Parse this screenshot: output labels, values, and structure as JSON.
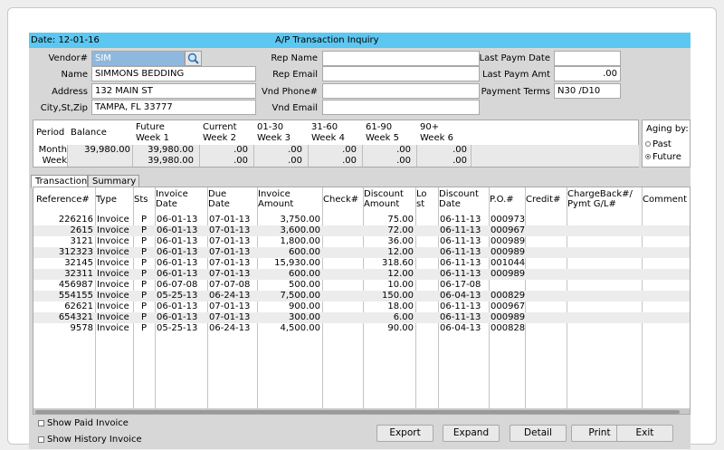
{
  "header": {
    "date": "Date: 12-01-16",
    "title": "A/P Transaction Inquiry"
  },
  "vendor": {
    "vendor_label": "Vendor#",
    "vendor_value": "SIM",
    "name_label": "Name",
    "name_value": "SIMMONS BEDDING",
    "address_label": "Address",
    "address_value": "132 MAIN ST",
    "city_label": "City,St,Zip",
    "city_value": "TAMPA, FL  33777",
    "rep_name_label": "Rep Name",
    "rep_name_value": "",
    "rep_email_label": "Rep Email",
    "rep_email_value": "",
    "vnd_phone_label": "Vnd Phone#",
    "vnd_phone_value": "",
    "vnd_email_label": "Vnd Email",
    "vnd_email_value": "",
    "last_paym_date_label": "Last Paym Date",
    "last_paym_date_value": "",
    "last_paym_amt_label": "Last Paym Amt",
    "last_paym_amt_value": ".00",
    "payment_terms_label": "Payment Terms",
    "payment_terms_value": "N30 /D10"
  },
  "aging": {
    "headers": [
      {
        "l1": "Period",
        "l2": ""
      },
      {
        "l1": "Balance",
        "l2": ""
      },
      {
        "l1": "Future",
        "l2": "Week 1"
      },
      {
        "l1": "Current",
        "l2": "Week 2"
      },
      {
        "l1": "01-30",
        "l2": "Week 3"
      },
      {
        "l1": "31-60",
        "l2": "Week 4"
      },
      {
        "l1": "61-90",
        "l2": "Week 5"
      },
      {
        "l1": "90+",
        "l2": "Week 6"
      }
    ],
    "rows": [
      {
        "period": "Month",
        "values": [
          "39,980.00",
          "39,980.00",
          ".00",
          ".00",
          ".00",
          ".00",
          ".00"
        ]
      },
      {
        "period": "Week",
        "values": [
          "",
          "39,980.00",
          ".00",
          ".00",
          ".00",
          ".00",
          ".00"
        ]
      }
    ],
    "aging_by_label": "Aging by:",
    "options": [
      "Past",
      "Future"
    ],
    "selected": "Future"
  },
  "tabs": [
    "Transaction",
    "Summary"
  ],
  "table": {
    "columns": [
      {
        "l1": "Reference#",
        "l2": ""
      },
      {
        "l1": "Type",
        "l2": ""
      },
      {
        "l1": "Sts",
        "l2": ""
      },
      {
        "l1": "Invoice",
        "l2": "Date"
      },
      {
        "l1": "Due",
        "l2": "Date"
      },
      {
        "l1": "Invoice",
        "l2": "Amount"
      },
      {
        "l1": "Check#",
        "l2": ""
      },
      {
        "l1": "Discount",
        "l2": "Amount"
      },
      {
        "l1": "Lo",
        "l2": "st"
      },
      {
        "l1": "Discount",
        "l2": "Date"
      },
      {
        "l1": "P.O.#",
        "l2": ""
      },
      {
        "l1": "Credit#",
        "l2": ""
      },
      {
        "l1": "ChargeBack#/",
        "l2": "Pymt G/L#"
      },
      {
        "l1": "Comment",
        "l2": ""
      }
    ],
    "rows": [
      [
        "226216",
        "Invoice",
        "P",
        "06-01-13",
        "07-01-13",
        "3,750.00",
        "",
        "75.00",
        "",
        "06-11-13",
        "000973",
        "",
        "",
        ""
      ],
      [
        "2615",
        "Invoice",
        "P",
        "06-01-13",
        "07-01-13",
        "3,600.00",
        "",
        "72.00",
        "",
        "06-11-13",
        "000967",
        "",
        "",
        ""
      ],
      [
        "3121",
        "Invoice",
        "P",
        "06-01-13",
        "07-01-13",
        "1,800.00",
        "",
        "36.00",
        "",
        "06-11-13",
        "000989",
        "",
        "",
        ""
      ],
      [
        "312323",
        "Invoice",
        "P",
        "06-01-13",
        "07-01-13",
        "600.00",
        "",
        "12.00",
        "",
        "06-11-13",
        "000989",
        "",
        "",
        ""
      ],
      [
        "32145",
        "Invoice",
        "P",
        "06-01-13",
        "07-01-13",
        "15,930.00",
        "",
        "318.60",
        "",
        "06-11-13",
        "001044",
        "",
        "",
        ""
      ],
      [
        "32311",
        "Invoice",
        "P",
        "06-01-13",
        "07-01-13",
        "600.00",
        "",
        "12.00",
        "",
        "06-11-13",
        "000989",
        "",
        "",
        ""
      ],
      [
        "456987",
        "Invoice",
        "P",
        "06-07-08",
        "07-07-08",
        "500.00",
        "",
        "10.00",
        "",
        "06-17-08",
        "",
        "",
        "",
        ""
      ],
      [
        "554155",
        "Invoice",
        "P",
        "05-25-13",
        "06-24-13",
        "7,500.00",
        "",
        "150.00",
        "",
        "06-04-13",
        "000829",
        "",
        "",
        ""
      ],
      [
        "62621",
        "Invoice",
        "P",
        "06-01-13",
        "07-01-13",
        "900.00",
        "",
        "18.00",
        "",
        "06-11-13",
        "000967",
        "",
        "",
        ""
      ],
      [
        "654321",
        "Invoice",
        "P",
        "06-01-13",
        "07-01-13",
        "300.00",
        "",
        "6.00",
        "",
        "06-11-13",
        "000989",
        "",
        "",
        ""
      ],
      [
        "9578",
        "Invoice",
        "P",
        "05-25-13",
        "06-24-13",
        "4,500.00",
        "",
        "90.00",
        "",
        "06-04-13",
        "000828",
        "",
        "",
        ""
      ]
    ]
  },
  "options": {
    "show_paid": "Show Paid Invoice",
    "show_history": "Show History Invoice"
  },
  "buttons": {
    "export": "Export",
    "expand": "Expand",
    "detail": "Detail",
    "print": "Print",
    "exit": "Exit"
  }
}
